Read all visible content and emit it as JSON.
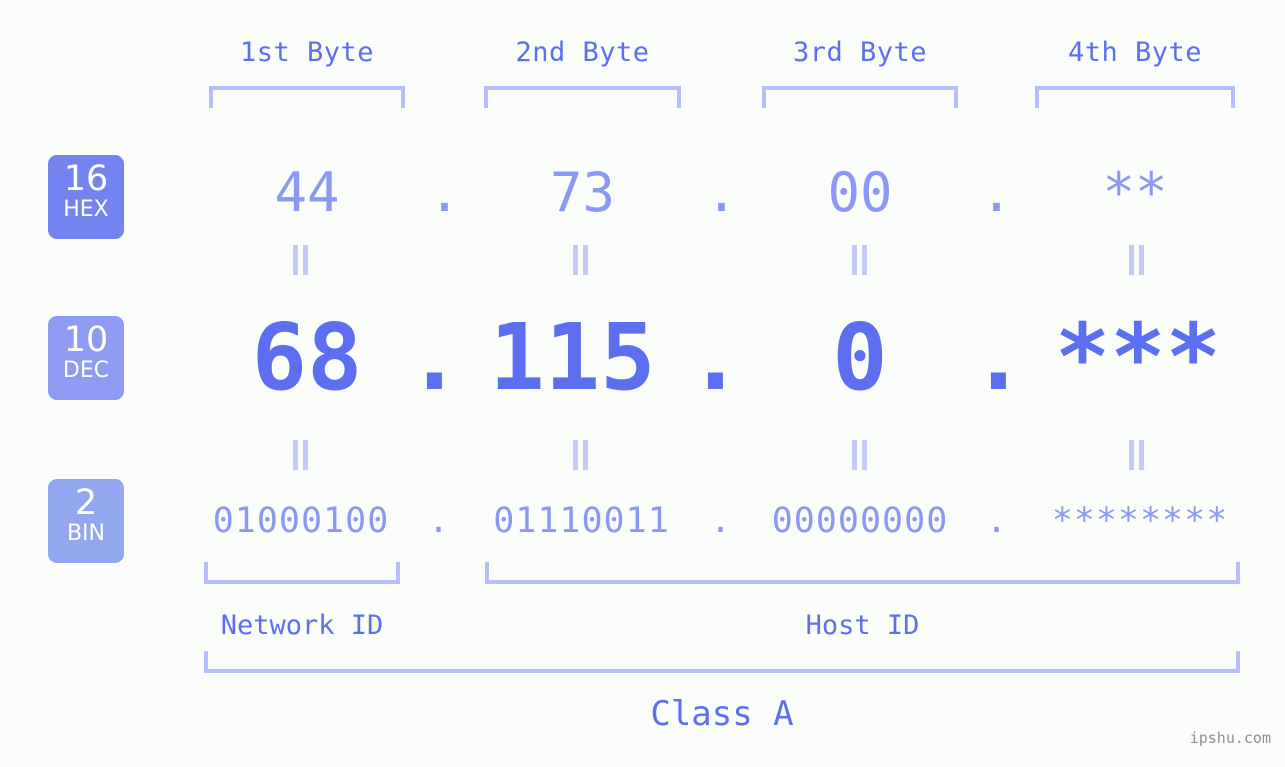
{
  "meta": {
    "background_color": "#fbfdfa",
    "accent_color": "#5b6ff0",
    "accent_light_color": "#8b99f2",
    "bracket_color": "#b5bdfb"
  },
  "byte_headers": [
    {
      "label": "1st Byte"
    },
    {
      "label": "2nd Byte"
    },
    {
      "label": "3rd Byte"
    },
    {
      "label": "4th Byte"
    }
  ],
  "bases": [
    {
      "number": "16",
      "abbr": "HEX",
      "color": "#7383f0"
    },
    {
      "number": "10",
      "abbr": "DEC",
      "color": "#8d9bf3"
    },
    {
      "number": "2",
      "abbr": "BIN",
      "color": "#92a7f0"
    }
  ],
  "rows": {
    "hex": {
      "base_label": "HEX",
      "values": [
        "44",
        "73",
        "00",
        "**"
      ],
      "separator": "."
    },
    "dec": {
      "base_label": "DEC",
      "values": [
        "68",
        "115",
        "0",
        "***"
      ],
      "separator": "."
    },
    "bin": {
      "base_label": "BIN",
      "values": [
        "01000100",
        "01110011",
        "00000000",
        "********"
      ],
      "separator": "."
    }
  },
  "equivalence_symbol": "=",
  "sections": {
    "network_id": "Network ID",
    "host_id": "Host ID",
    "class": "Class A"
  },
  "watermark": "ipshu.com"
}
